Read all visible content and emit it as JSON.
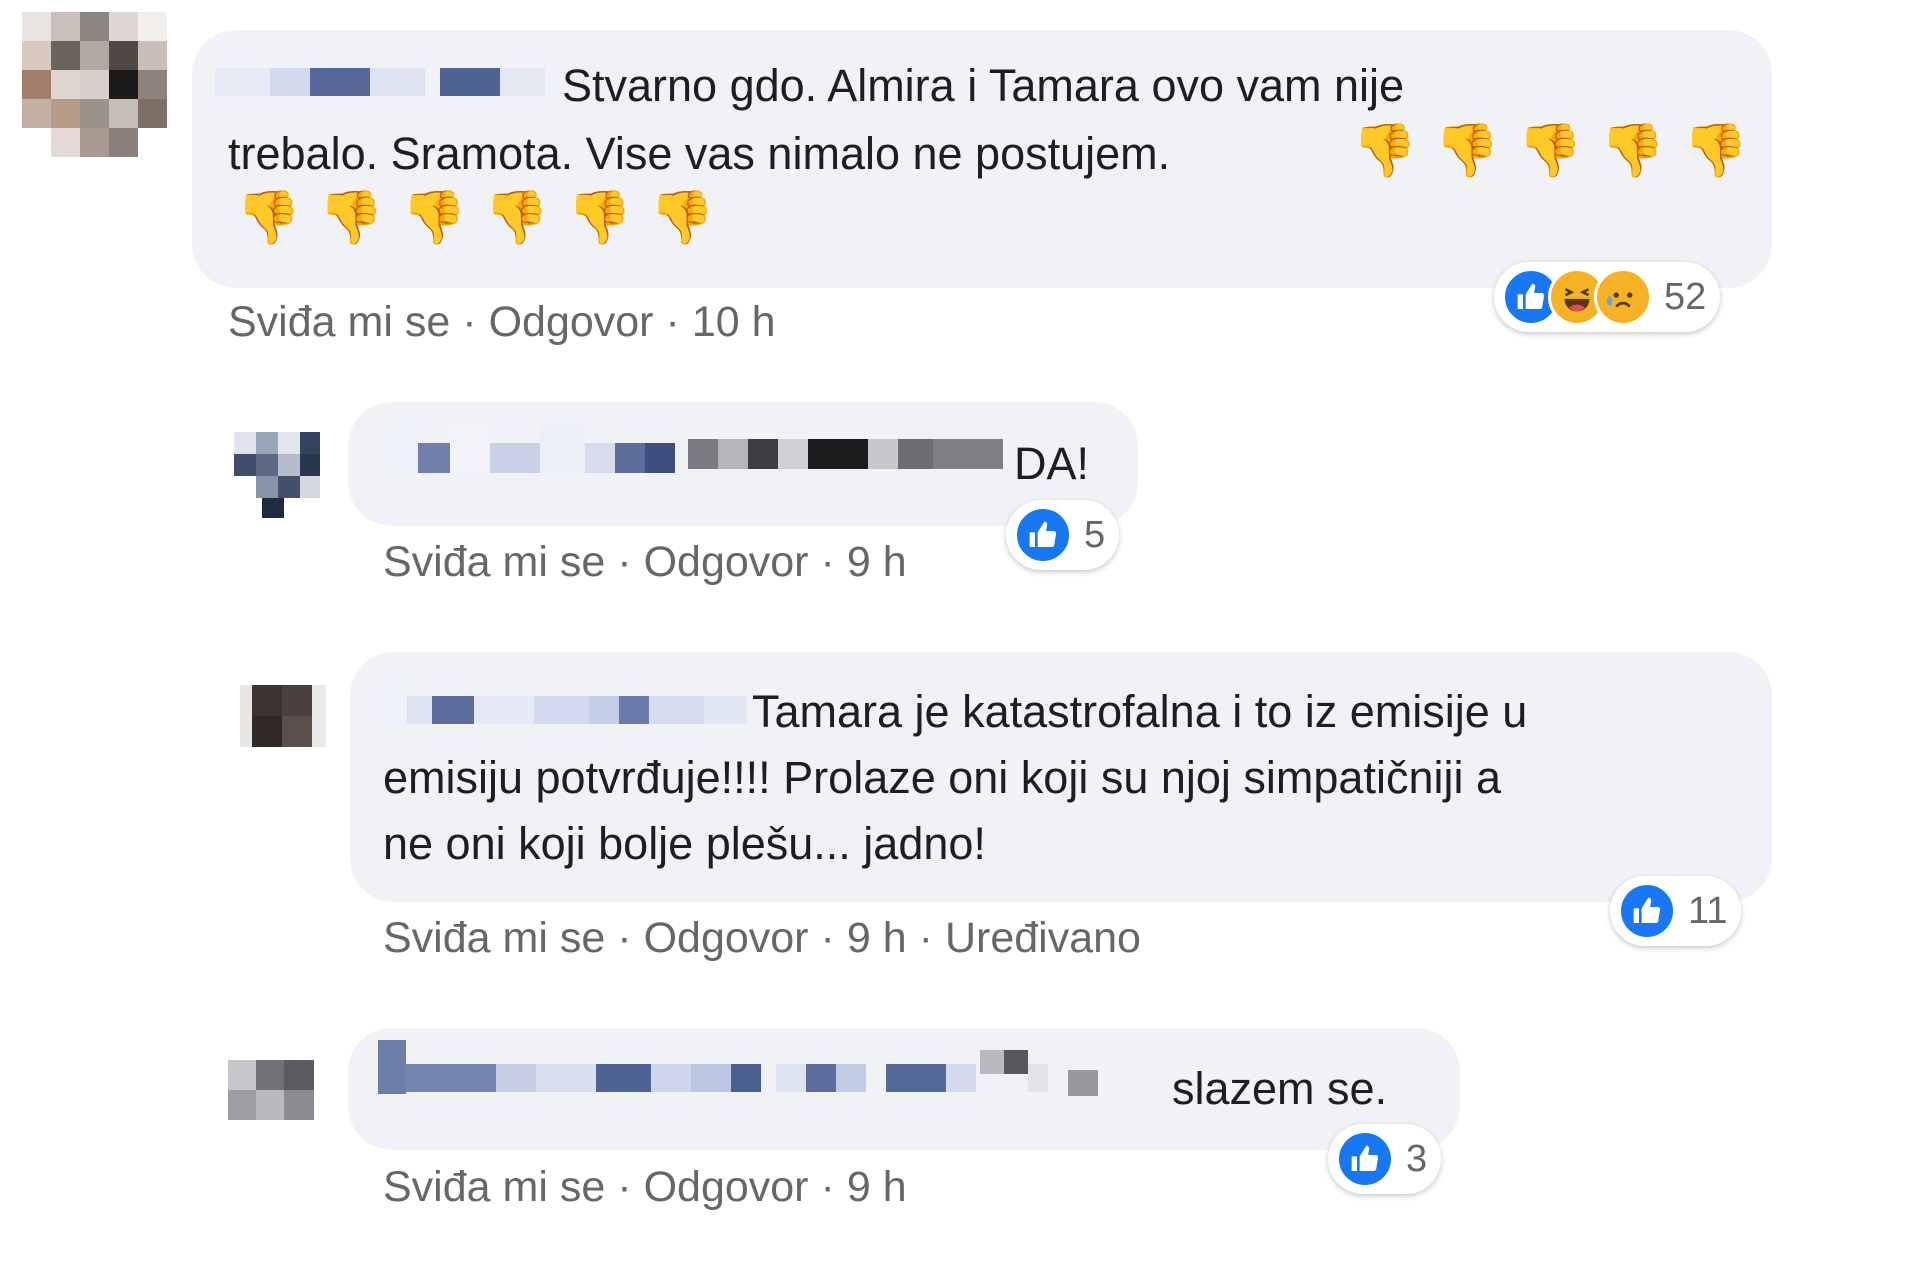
{
  "colors": {
    "bubble": "#f0f2f5",
    "meta_text": "#65676b",
    "like_blue": "#1877f2",
    "emoji_yellow": "#f7b125"
  },
  "comments": [
    {
      "text_line1": "Stvarno gdo. Almira i Tamara ovo vam nije",
      "text_line2": "trebalo. Sramota. Vise vas nimalo ne postujem.",
      "emoji": "👎",
      "emoji_count_line2": 5,
      "emoji_count_line3": 6,
      "reactions": [
        "like-icon",
        "haha-icon",
        "sad-icon"
      ],
      "reaction_count": "52",
      "like_label": "Sviđa mi se",
      "reply_label": "Odgovor",
      "time": "10 h"
    },
    {
      "text_line1": "DA!",
      "reactions": [
        "like-icon"
      ],
      "reaction_count": "5",
      "like_label": "Sviđa mi se",
      "reply_label": "Odgovor",
      "time": "9 h"
    },
    {
      "text_line1": "Tamara je katastrofalna i to iz emisije u",
      "text_line2": "emisiju potvrđuje!!!! Prolaze oni koji su njoj simpatičniji a",
      "text_line3": "ne oni koji bolje plešu... jadno!",
      "reactions": [
        "like-icon"
      ],
      "reaction_count": "11",
      "like_label": "Sviđa mi se",
      "reply_label": "Odgovor",
      "time": "9 h",
      "edited_label": "Uređivano"
    },
    {
      "text_line1": "slazem se.",
      "reactions": [
        "like-icon"
      ],
      "reaction_count": "3",
      "like_label": "Sviđa mi se",
      "reply_label": "Odgovor",
      "time": "9 h"
    }
  ]
}
